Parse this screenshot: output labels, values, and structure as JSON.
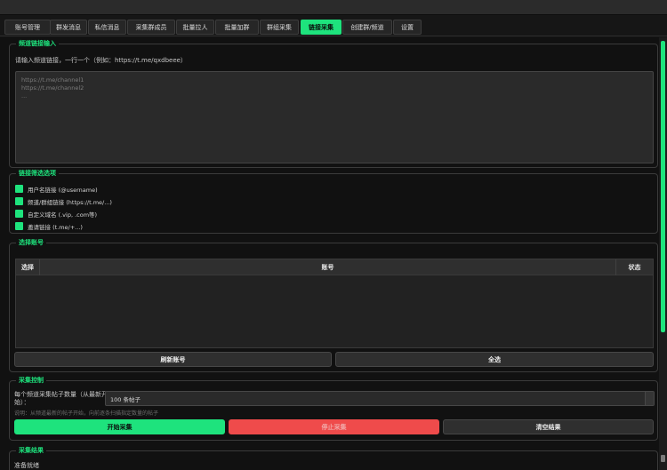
{
  "tabs": [
    {
      "label": "账号管理"
    },
    {
      "label": "群发消息"
    },
    {
      "label": "私信消息"
    },
    {
      "label": "采集群成员"
    },
    {
      "label": "批量拉人"
    },
    {
      "label": "批量加群"
    },
    {
      "label": "群组采集"
    },
    {
      "label": "链接采集"
    },
    {
      "label": "创建群/频道"
    },
    {
      "label": "设置"
    }
  ],
  "active_tab_index": 7,
  "channel_input": {
    "title": "频道链接输入",
    "hint": "请输入频道链接，一行一个（例如：https://t.me/qxdbeee）",
    "placeholder_lines": [
      "https://t.me/channel1",
      "https://t.me/channel2",
      "..."
    ]
  },
  "filter": {
    "title": "链接筛选选项",
    "options": [
      {
        "label": "用户名链接 (@username)",
        "checked": true
      },
      {
        "label": "频道/群组链接 (https://t.me/...)",
        "checked": true
      },
      {
        "label": "自定义域名 (.vip, .com等)",
        "checked": true
      },
      {
        "label": "邀请链接 (t.me/+...)",
        "checked": true
      }
    ]
  },
  "accounts": {
    "title": "选择账号",
    "columns": [
      "选择",
      "账号",
      "状态"
    ],
    "rows": [],
    "refresh_label": "刷新账号",
    "select_all_label": "全选"
  },
  "control": {
    "title": "采集控制",
    "count_label_line1": "每个频道采集帖子数量（从最新开",
    "count_label_line2": "始）：",
    "count_value": "100 条帖子",
    "note": "说明：从频道最新的帖子开始，向前逐条扫描指定数量的帖子",
    "start_label": "开始采集",
    "stop_label": "停止采集",
    "clear_label": "清空结果"
  },
  "results": {
    "title": "采集结果",
    "status": "准备就绪"
  },
  "colors": {
    "accent": "#1ee37d",
    "danger": "#ef4b4b",
    "background": "#111111"
  }
}
